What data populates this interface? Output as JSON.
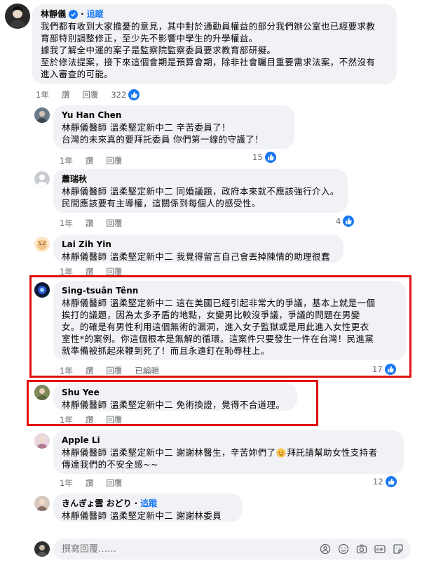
{
  "main_comment": {
    "author": "林靜儀",
    "follow_label": "追蹤",
    "lines": [
      "我們都有收到大家擔憂的意見，其中對於通勤員權益的部分我們辦公室也已經要求教",
      "育部特別調整修正，至少先不影響中學生的升學權益。",
      "據我了解全中運的案子是監察院監察委員要求教育部研擬。",
      "至於修法提案，接下來這個會期是預算會期，除非社會矚目重要需求法案，不然沒有",
      "進入審查的可能。"
    ],
    "time": "1年",
    "like_label": "讚",
    "reply_label": "回覆",
    "reaction_count": "322"
  },
  "replies": [
    {
      "author": "Yu Han Chen",
      "lines": [
        "林靜儀醫師 溫柔堅定新中二 辛苦委員了！",
        "台灣的未來真的要拜託委員 你們第一線的守護了！"
      ],
      "time": "1年",
      "like_label": "讚",
      "reply_label": "回覆",
      "reaction_count": "15"
    },
    {
      "author": "蕭瑞秋",
      "lines": [
        "林靜儀醫師 溫柔堅定新中二 同婚議題，政府本來就不應該強行介入。",
        "民間應該要有主導權，這關係到每個人的感受性。"
      ],
      "time": "1年",
      "like_label": "讚",
      "reply_label": "回覆",
      "reaction_count": "4"
    },
    {
      "author": "Lai Zih Yin",
      "lines": [
        "林靜儀醫師 溫柔堅定新中二 我覺得留言自己會丟掉陳情的助理很蠢"
      ],
      "time": "1年",
      "like_label": "讚",
      "reply_label": "回覆",
      "reaction_count": ""
    },
    {
      "author": "Sing-tsuân Tênn",
      "lines": [
        "林靜儀醫師 溫柔堅定新中二 這在美國已經引起非常大的爭議，基本上就是一個",
        "挨打的議題，因為太多矛盾的地點，女變男比較沒爭議，爭議的問題在男變",
        "女。的確是有男性利用這個無術的漏洞，進入女子監獄或是用此進入女性更衣",
        "室性*的案例。你這個根本是無解的循環。這案件只要發生一件在台灣！民進黨",
        "就準備被抓起來鞭到死了！而且永遠釘在恥辱柱上。"
      ],
      "time": "1年",
      "like_label": "讚",
      "reply_label": "回覆",
      "edited_label": "已編輯",
      "reaction_count": "17"
    },
    {
      "author": "Shu Yee",
      "lines": [
        "林靜儀醫師 溫柔堅定新中二 免術換證，覺得不合道理。"
      ],
      "time": "1年",
      "like_label": "讚",
      "reply_label": "回覆",
      "reaction_count": ""
    },
    {
      "author": "Apple Li",
      "lines": [
        "林靜儀醫師 溫柔堅定新中二 謝謝林醫生，辛苦妳們了",
        "傳達我們的不安全感~~"
      ],
      "line1_tail": "拜託請幫助女性支持者",
      "time": "1年",
      "like_label": "讚",
      "reply_label": "回覆",
      "reaction_count": "12"
    },
    {
      "author": "きんぎょ雲 おどり",
      "follow_label": "追蹤",
      "lines": [
        "林靜儀醫師 溫柔堅定新中二 謝謝林委員"
      ],
      "time": "1年",
      "like_label": "讚",
      "reply_label": "回覆",
      "reaction_count": ""
    }
  ],
  "composer": {
    "placeholder": "撰寫回覆……"
  },
  "colors": {
    "accent": "#1877f2",
    "highlight_border": "#e01010",
    "bubble": "#f0f2f5",
    "meta": "#65676b"
  },
  "icons": [
    "verified-badge-icon",
    "like-reaction-icon",
    "emoji-icon",
    "camera-icon",
    "gif-icon",
    "sticker-icon",
    "avatar-icon"
  ]
}
